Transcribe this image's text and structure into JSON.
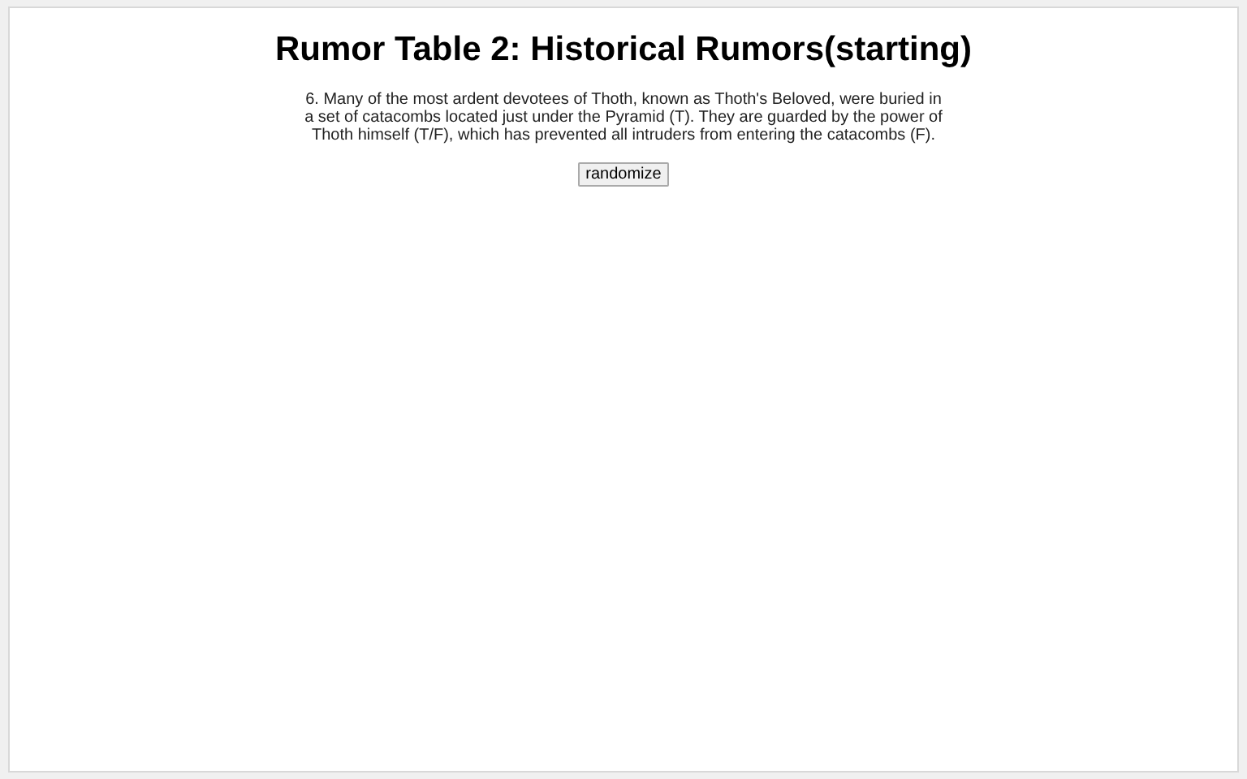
{
  "title": "Rumor Table 2: Historical Rumors(starting)",
  "rumor": "6. Many of the most ardent devotees of Thoth, known as Thoth's Beloved, were buried in a set of catacombs located just under the Pyramid (T). They are guarded by the power of Thoth himself (T/F), which has prevented all intruders from entering the catacombs (F).",
  "button": "randomize"
}
